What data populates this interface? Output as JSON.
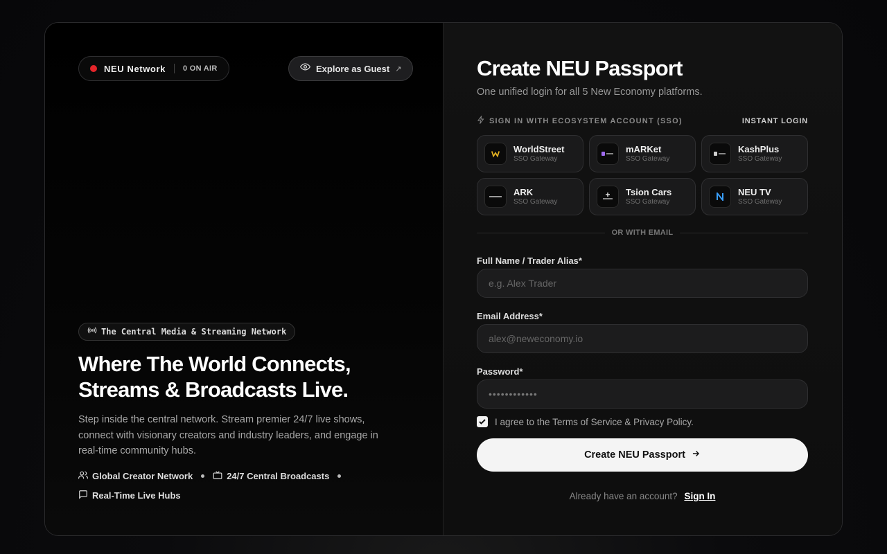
{
  "left": {
    "network_pill": {
      "name": "NEU Network",
      "status": "0 ON AIR"
    },
    "guest_button": {
      "label": "Explore as Guest",
      "arrow": "↗"
    },
    "tag": "The Central Media & Streaming Network",
    "headline": "Where The World Connects, Streams & Broadcasts Live.",
    "description": "Step inside the central network. Stream premier 24/7 live shows, connect with visionary creators and industry leaders, and engage in real-time community hubs.",
    "features": [
      {
        "label": "Global Creator Network",
        "icon": "users-icon"
      },
      {
        "label": "24/7 Central Broadcasts",
        "icon": "tv-icon"
      },
      {
        "label": "Real-Time Live Hubs",
        "icon": "chat-icon"
      }
    ]
  },
  "form": {
    "title": "Create NEU Passport",
    "subtitle": "One unified login for all 5 New Economy platforms.",
    "sso_heading": "SIGN IN WITH ECOSYSTEM ACCOUNT (SSO)",
    "instant_login": "INSTANT LOGIN",
    "sso_providers": [
      {
        "name": "WorldStreet",
        "sub": "SSO Gateway"
      },
      {
        "name": "mARKet",
        "sub": "SSO Gateway"
      },
      {
        "name": "KashPlus",
        "sub": "SSO Gateway"
      },
      {
        "name": "ARK",
        "sub": "SSO Gateway"
      },
      {
        "name": "Tsion Cars",
        "sub": "SSO Gateway"
      },
      {
        "name": "NEU TV",
        "sub": "SSO Gateway"
      }
    ],
    "divider": "OR WITH EMAIL",
    "name_label": "Full Name / Trader Alias*",
    "name_placeholder": "e.g. Alex Trader",
    "email_label": "Email Address*",
    "email_placeholder": "alex@neweconomy.io",
    "password_label": "Password*",
    "password_value": "••••••••••••",
    "agree_text": "I agree to the Terms of Service & Privacy Policy.",
    "submit_label": "Create NEU Passport",
    "have_account": "Already have an account?",
    "signin_label": "Sign In"
  },
  "colors": {
    "live_dot": "#e5252a",
    "accent_blue": "#3aa0ff",
    "button_bg": "#f4f4f4"
  }
}
